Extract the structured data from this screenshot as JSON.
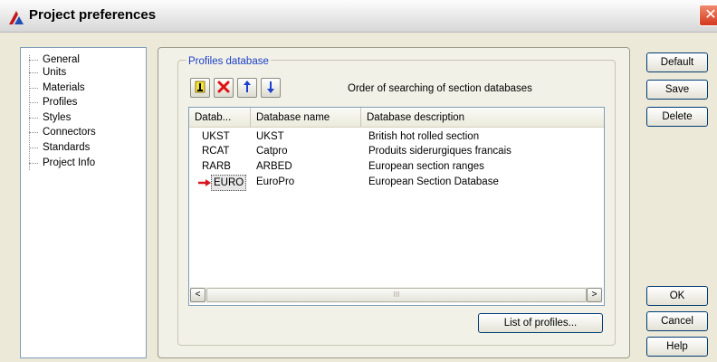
{
  "window": {
    "title": "Project preferences",
    "close_icon": "close-x-icon"
  },
  "tree": {
    "items": [
      {
        "label": "General"
      },
      {
        "label": "Units"
      },
      {
        "label": "Materials"
      },
      {
        "label": "Profiles"
      },
      {
        "label": "Styles"
      },
      {
        "label": "Connectors"
      },
      {
        "label": "Standards"
      },
      {
        "label": "Project Info"
      }
    ]
  },
  "profiles": {
    "group_label": "Profiles database",
    "order_label": "Order of searching of section databases",
    "toolbar": {
      "add_icon": "add-database-icon",
      "delete_icon": "delete-red-x-icon",
      "up_icon": "move-up-arrow-icon",
      "down_icon": "move-down-arrow-icon"
    },
    "columns": [
      "Datab...",
      "Database name",
      "Database description"
    ],
    "rows": [
      {
        "code": "UKST",
        "name": "UKST",
        "description": "British hot rolled section",
        "current": false
      },
      {
        "code": "RCAT",
        "name": "Catpro",
        "description": "Produits siderurgiques francais",
        "current": false
      },
      {
        "code": "RARB",
        "name": "ARBED",
        "description": "European section ranges",
        "current": false
      },
      {
        "code": "EURO",
        "name": "EuroPro",
        "description": "European Section Database",
        "current": true
      }
    ],
    "list_profiles_label": "List of profiles...",
    "scroll_left": "<",
    "scroll_right": ">",
    "scroll_grip": "III"
  },
  "buttons": {
    "default": "Default",
    "save": "Save",
    "delete": "Delete",
    "ok": "OK",
    "cancel": "Cancel",
    "help": "Help"
  },
  "colors": {
    "group_label": "#1c3fc6",
    "close_button": "#d2391d",
    "delete_icon": "#e01010",
    "arrow_icon": "#1a3fd0",
    "current_row_arrow": "#d8141c"
  }
}
